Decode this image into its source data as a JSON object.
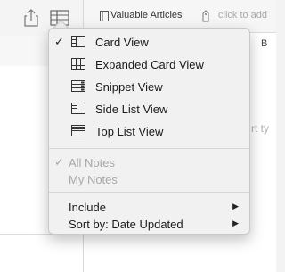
{
  "header": {
    "notebook_name": "Valuable Articles",
    "tag_placeholder": "click to add",
    "bold_label": "B",
    "ghost_text": "rt ty"
  },
  "menu": {
    "view_items": [
      {
        "label": "Card View",
        "icon": "card-view-icon",
        "checked": true
      },
      {
        "label": "Expanded Card View",
        "icon": "expanded-card-view-icon",
        "checked": false
      },
      {
        "label": "Snippet View",
        "icon": "snippet-view-icon",
        "checked": false
      },
      {
        "label": "Side List View",
        "icon": "side-list-view-icon",
        "checked": false
      },
      {
        "label": "Top List View",
        "icon": "top-list-view-icon",
        "checked": false
      }
    ],
    "scope_items": [
      {
        "label": "All Notes",
        "checked": true,
        "disabled": true
      },
      {
        "label": "My Notes",
        "checked": false,
        "disabled": true
      }
    ],
    "submenu_items": [
      {
        "label": "Include",
        "has_submenu": true
      },
      {
        "label": "Sort by: Date Updated",
        "has_submenu": true
      }
    ],
    "check_glyph": "✓",
    "submenu_glyph": "▶"
  }
}
